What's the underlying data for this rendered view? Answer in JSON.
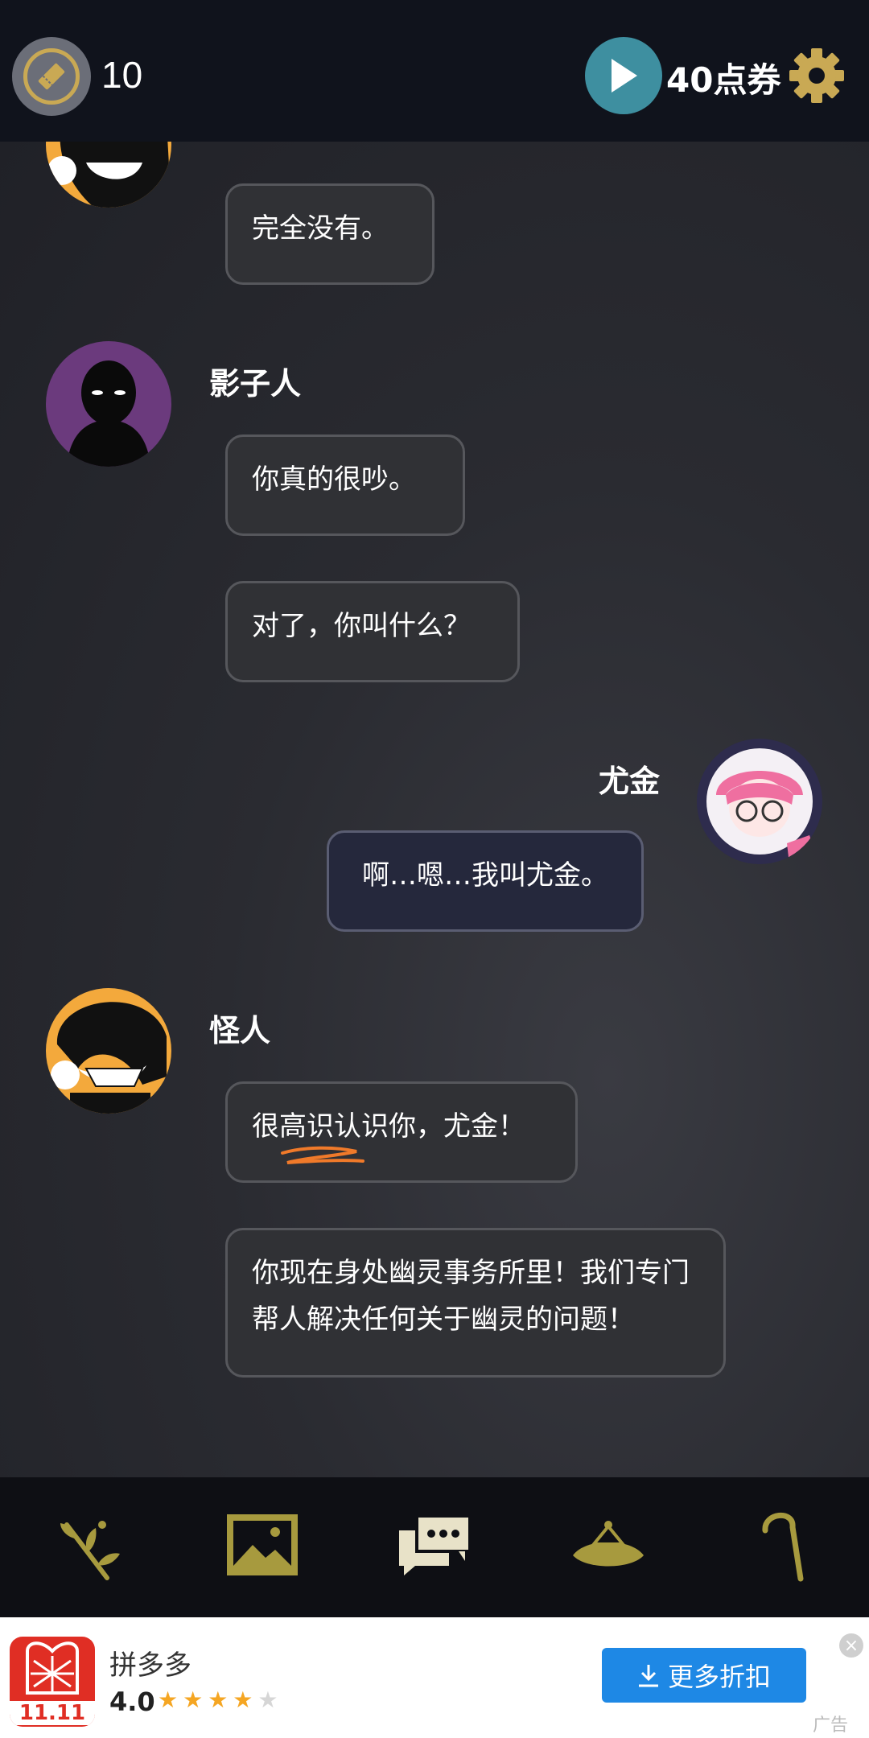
{
  "topbar": {
    "ticket_count": "10",
    "coupon_label": "40点券",
    "icons": {
      "ticket": "ticket-icon",
      "play": "play-icon",
      "settings": "gear-icon"
    },
    "accent_color": "#c9a954"
  },
  "chat": {
    "messages": [
      {
        "sender": "",
        "side": "left",
        "avatar": "weirdo-avatar",
        "text": "完全没有。"
      },
      {
        "sender": "影子人",
        "side": "left",
        "avatar": "shadow-man-avatar",
        "text": "你真的很吵。"
      },
      {
        "sender": "",
        "side": "left",
        "avatar": "",
        "text": "对了，你叫什么？"
      },
      {
        "sender": "尤金",
        "side": "right",
        "avatar": "eugene-avatar",
        "text": "啊…嗯…我叫尤金。"
      },
      {
        "sender": "怪人",
        "side": "left",
        "avatar": "weirdo-avatar",
        "text": "很高识认识你，尤金！"
      },
      {
        "sender": "",
        "side": "left",
        "avatar": "",
        "text": "你现在身处幽灵事务所里！我们专门帮人解决任何关于幽灵的问题！"
      }
    ]
  },
  "bottom_nav": {
    "items": [
      {
        "icon": "branch-icon"
      },
      {
        "icon": "picture-icon"
      },
      {
        "icon": "chat-icon",
        "active": true
      },
      {
        "icon": "hat-icon"
      },
      {
        "icon": "cane-icon"
      }
    ]
  },
  "ad": {
    "app_icon_text": "11.11",
    "app_name": "拼多多",
    "rating": "4.0",
    "stars_filled": 4,
    "stars_total": 5,
    "stars": "★★★★★",
    "button_label": "更多折扣",
    "close_label": "×",
    "ad_label": "广告"
  }
}
